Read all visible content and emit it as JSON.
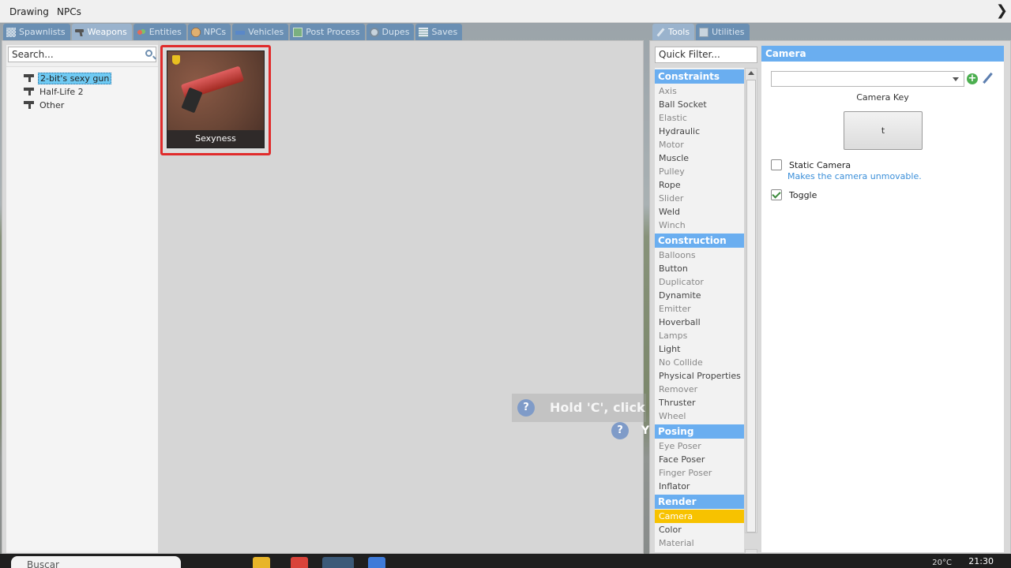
{
  "menu": {
    "items": [
      "Drawing",
      "NPCs"
    ]
  },
  "spawn_tabs": [
    {
      "label": "Spawnlists",
      "icon": "spawnlist-icon"
    },
    {
      "label": "Weapons",
      "icon": "weapons-icon"
    },
    {
      "label": "Entities",
      "icon": "entities-icon"
    },
    {
      "label": "NPCs",
      "icon": "npcs-icon"
    },
    {
      "label": "Vehicles",
      "icon": "vehicles-icon"
    },
    {
      "label": "Post Process",
      "icon": "post-process-icon"
    },
    {
      "label": "Dupes",
      "icon": "dupes-icon"
    },
    {
      "label": "Saves",
      "icon": "saves-icon"
    }
  ],
  "tool_tabs": [
    {
      "label": "Tools",
      "icon": "tools-icon"
    },
    {
      "label": "Utilities",
      "icon": "utilities-icon"
    }
  ],
  "weapons_panel": {
    "search_placeholder": "Search...",
    "tree": [
      {
        "label": "2-bit's sexy gun",
        "selected": true
      },
      {
        "label": "Half-Life 2",
        "selected": false
      },
      {
        "label": "Other",
        "selected": false
      }
    ],
    "card": {
      "caption": "Sexyness"
    }
  },
  "hint": {
    "text": "Hold 'C', click or",
    "text2": "Y",
    "icon": "question-icon"
  },
  "tools_panel": {
    "filter_placeholder": "Quick Filter...",
    "categories": [
      {
        "name": "Constraints",
        "items": [
          {
            "label": "Axis",
            "dim": true
          },
          {
            "label": "Ball Socket",
            "dim": false
          },
          {
            "label": "Elastic",
            "dim": true
          },
          {
            "label": "Hydraulic",
            "dim": false
          },
          {
            "label": "Motor",
            "dim": true
          },
          {
            "label": "Muscle",
            "dim": false
          },
          {
            "label": "Pulley",
            "dim": true
          },
          {
            "label": "Rope",
            "dim": false
          },
          {
            "label": "Slider",
            "dim": true
          },
          {
            "label": "Weld",
            "dim": false
          },
          {
            "label": "Winch",
            "dim": true
          }
        ]
      },
      {
        "name": "Construction",
        "items": [
          {
            "label": "Balloons",
            "dim": true
          },
          {
            "label": "Button",
            "dim": false
          },
          {
            "label": "Duplicator",
            "dim": true
          },
          {
            "label": "Dynamite",
            "dim": false
          },
          {
            "label": "Emitter",
            "dim": true
          },
          {
            "label": "Hoverball",
            "dim": false
          },
          {
            "label": "Lamps",
            "dim": true
          },
          {
            "label": "Light",
            "dim": false
          },
          {
            "label": "No Collide",
            "dim": true
          },
          {
            "label": "Physical Properties",
            "dim": false
          },
          {
            "label": "Remover",
            "dim": true
          },
          {
            "label": "Thruster",
            "dim": false
          },
          {
            "label": "Wheel",
            "dim": true
          }
        ]
      },
      {
        "name": "Posing",
        "items": [
          {
            "label": "Eye Poser",
            "dim": true
          },
          {
            "label": "Face Poser",
            "dim": false
          },
          {
            "label": "Finger Poser",
            "dim": true
          },
          {
            "label": "Inflator",
            "dim": false
          }
        ]
      },
      {
        "name": "Render",
        "items": [
          {
            "label": "Camera",
            "dim": false,
            "selected": true
          },
          {
            "label": "Color",
            "dim": false
          },
          {
            "label": "Material",
            "dim": true
          }
        ]
      }
    ]
  },
  "camera_settings": {
    "title": "Camera",
    "preset_value": "",
    "key_label": "Camera Key",
    "key_value": "t",
    "static_label": "Static Camera",
    "static_checked": false,
    "static_help": "Makes the camera unmovable.",
    "toggle_label": "Toggle",
    "toggle_checked": true
  },
  "taskbar": {
    "search_text": "Buscar",
    "time": "21:30",
    "tray_text": "20°C"
  }
}
